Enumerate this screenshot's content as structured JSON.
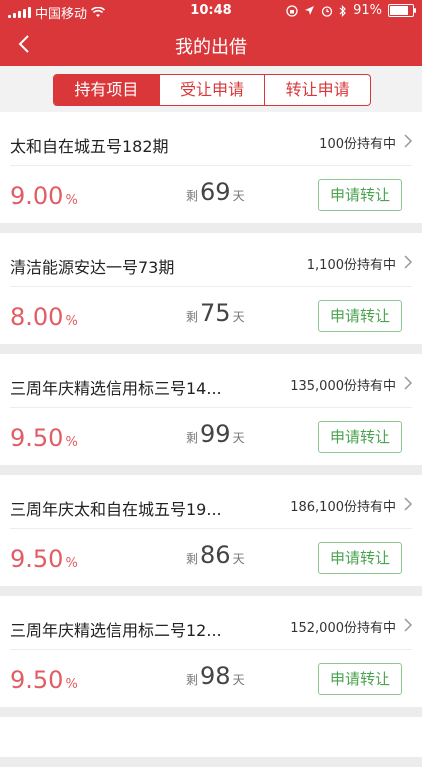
{
  "status_bar": {
    "carrier": "中国移动",
    "time": "10:48",
    "battery_percent": "91%",
    "battery_level": 0.91
  },
  "nav": {
    "title": "我的出借",
    "back_icon": "chevron-left-icon"
  },
  "tabs": [
    {
      "label": "持有项目",
      "active": true
    },
    {
      "label": "受让申请",
      "active": false
    },
    {
      "label": "转让申请",
      "active": false
    }
  ],
  "items": [
    {
      "name": "太和自在城五号182期",
      "holding": "100份持有中",
      "rate": "9.00",
      "rate_unit": "%",
      "remain_label": "剩",
      "days": "69",
      "days_unit": "天",
      "button": "申请转让"
    },
    {
      "name": "清洁能源安达一号73期",
      "holding": "1,100份持有中",
      "rate": "8.00",
      "rate_unit": "%",
      "remain_label": "剩",
      "days": "75",
      "days_unit": "天",
      "button": "申请转让"
    },
    {
      "name": "三周年庆精选信用标三号14...",
      "holding": "135,000份持有中",
      "rate": "9.50",
      "rate_unit": "%",
      "remain_label": "剩",
      "days": "99",
      "days_unit": "天",
      "button": "申请转让"
    },
    {
      "name": "三周年庆太和自在城五号19...",
      "holding": "186,100份持有中",
      "rate": "9.50",
      "rate_unit": "%",
      "remain_label": "剩",
      "days": "86",
      "days_unit": "天",
      "button": "申请转让"
    },
    {
      "name": "三周年庆精选信用标二号12...",
      "holding": "152,000份持有中",
      "rate": "9.50",
      "rate_unit": "%",
      "remain_label": "剩",
      "days": "98",
      "days_unit": "天",
      "button": "申请转让"
    }
  ],
  "colors": {
    "brand_red": "#d9373a",
    "rate_red": "#e25d63",
    "button_green": "#4aa34f"
  }
}
